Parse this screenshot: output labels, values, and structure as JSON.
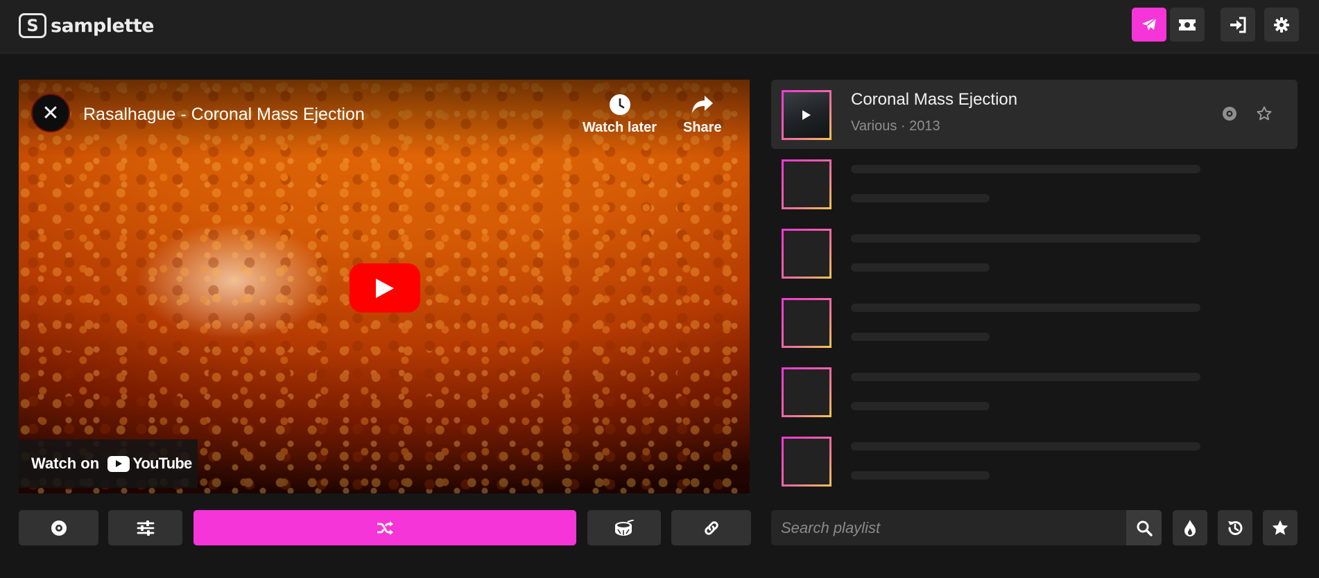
{
  "app": {
    "logo_mark": "S",
    "logo_text": "samplette",
    "accent_color": "#f535d7"
  },
  "topbar": {
    "buttons": [
      {
        "icon": "paper-plane-icon",
        "active": true
      },
      {
        "icon": "ticket-icon",
        "active": false
      },
      {
        "icon": "sign-in-icon",
        "active": false
      },
      {
        "icon": "gear-icon",
        "active": false
      }
    ]
  },
  "video": {
    "title": "Rasalhague - Coronal Mass Ejection",
    "channel_avatar_glyph": "✕",
    "watch_later_label": "Watch later",
    "share_label": "Share",
    "watch_on_label": "Watch on",
    "youtube_label": "YouTube"
  },
  "controls": {
    "buttons": [
      {
        "icon": "disc-icon"
      },
      {
        "icon": "sliders-icon"
      },
      {
        "icon": "shuffle-icon",
        "primary": true
      },
      {
        "icon": "drum-icon"
      },
      {
        "icon": "link-icon"
      }
    ]
  },
  "playlist": {
    "current": {
      "title": "Coronal Mass Ejection",
      "subtitle": "Various · 2013"
    },
    "placeholder_rows": 5,
    "search_placeholder": "Search playlist"
  },
  "playlist_actions": [
    {
      "icon": "search-icon"
    },
    {
      "icon": "fire-icon"
    },
    {
      "icon": "history-icon"
    },
    {
      "icon": "star-icon"
    }
  ]
}
